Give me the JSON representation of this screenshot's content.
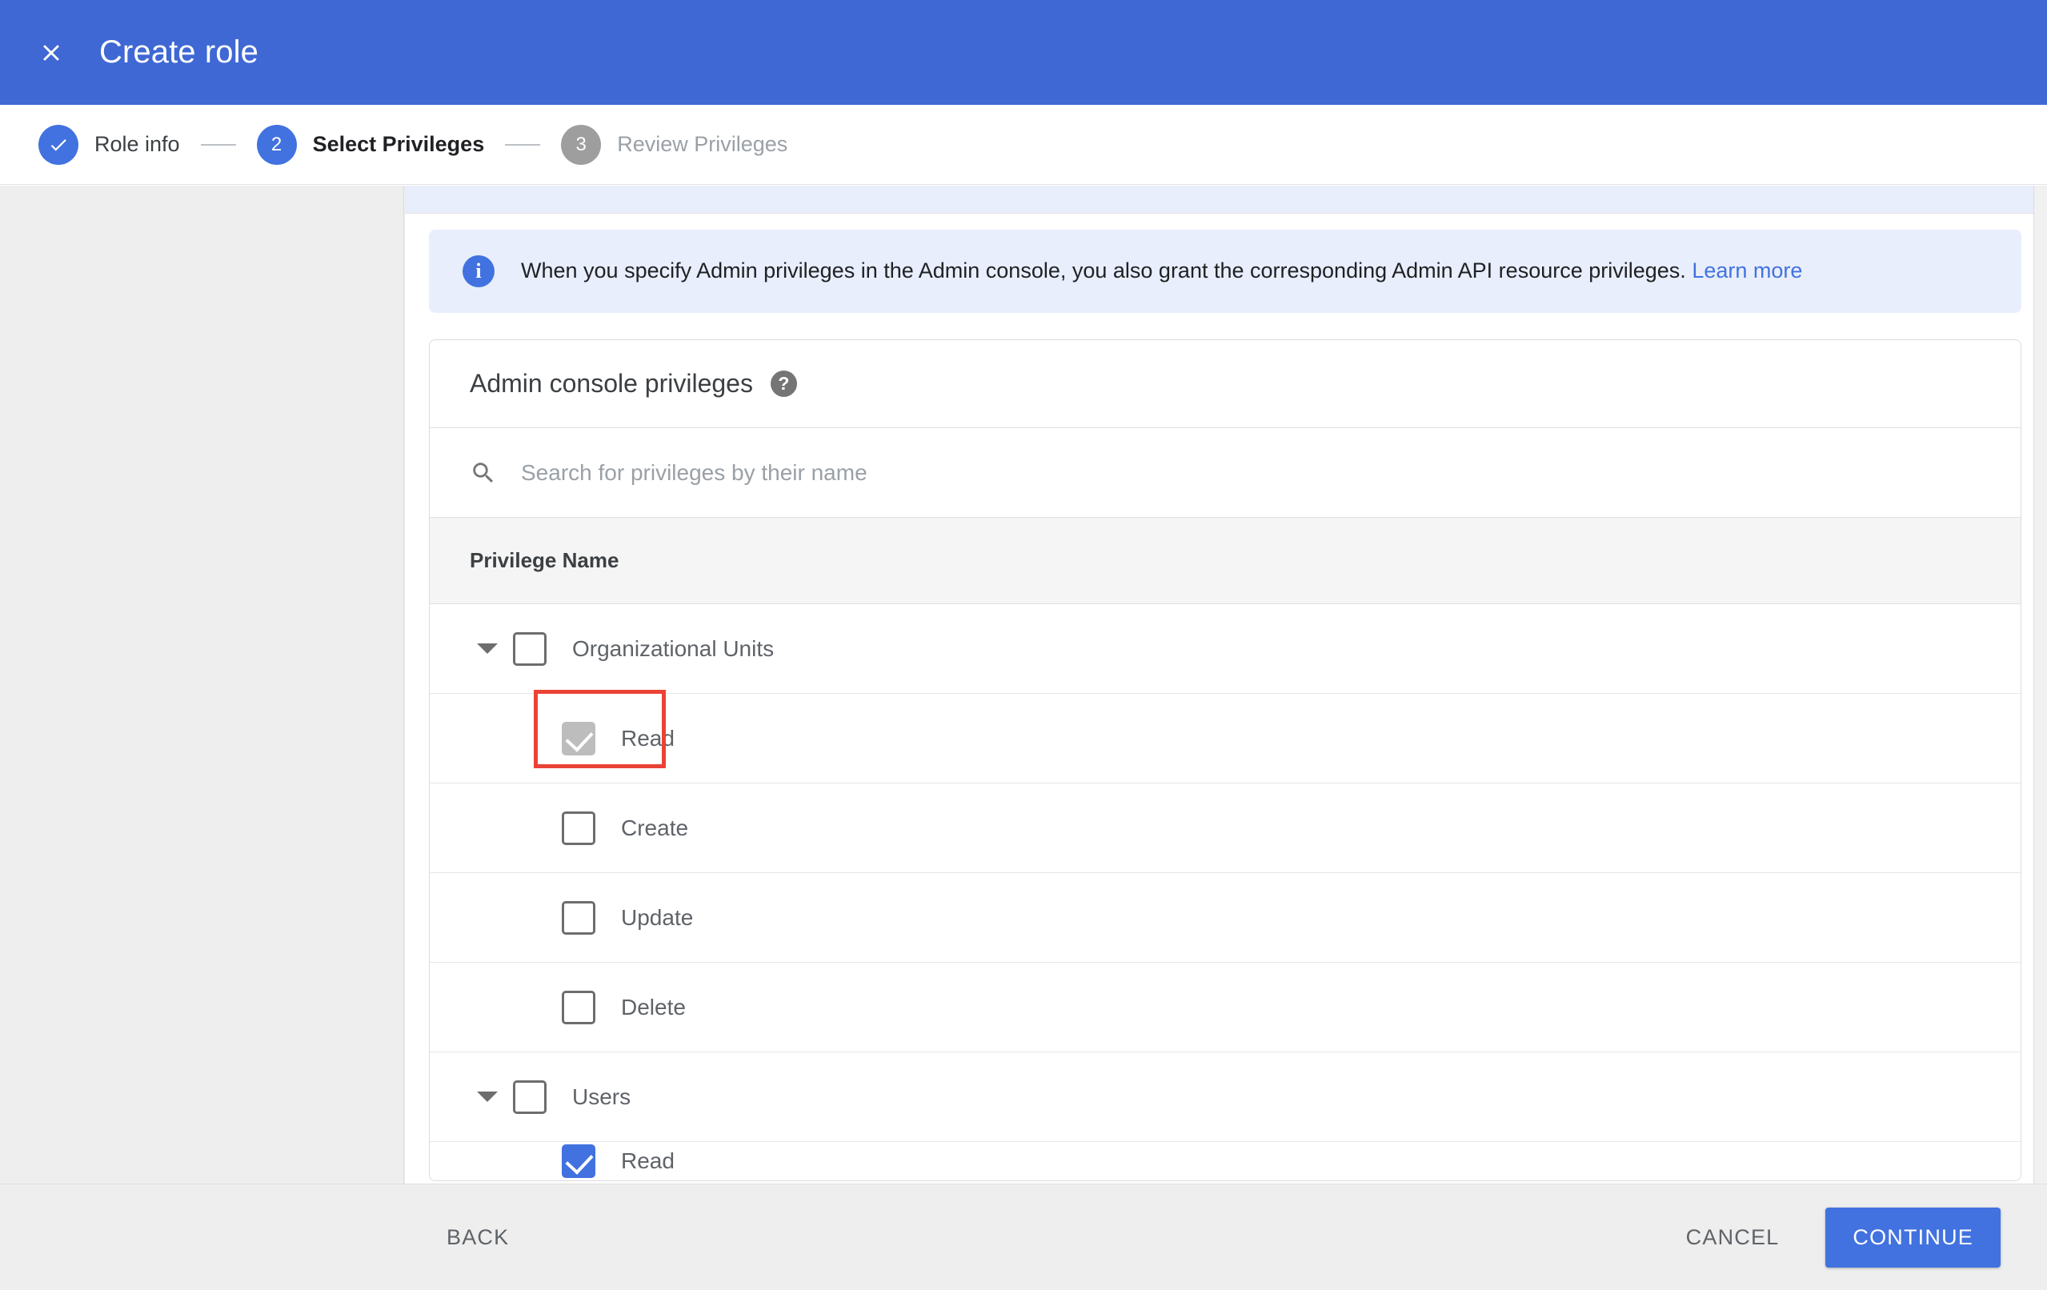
{
  "topbar": {
    "close_icon": "close-icon",
    "title": "Create role",
    "background_color": "#3f68d4"
  },
  "stepper": {
    "steps": [
      {
        "marker": "✓",
        "label": "Role info",
        "state": "done"
      },
      {
        "marker": "2",
        "label": "Select Privileges",
        "state": "active"
      },
      {
        "marker": "3",
        "label": "Review Privileges",
        "state": "inactive"
      }
    ]
  },
  "info_banner": {
    "icon": "info-icon",
    "text": "When you specify Admin privileges in the Admin console, you also grant the corresponding Admin API resource privileges.",
    "link_label": "Learn more",
    "background_color": "#e8eefc",
    "link_color": "#4272e0"
  },
  "privileges_card": {
    "title": "Admin console privileges",
    "help_icon": "help-icon",
    "search": {
      "icon": "search-icon",
      "value": "",
      "placeholder": "Search for privileges by their name"
    },
    "table": {
      "column_header": "Privilege Name",
      "rows": [
        {
          "label": "Organizational Units",
          "level": "group",
          "checked": false,
          "state": "unchecked",
          "caret": "chevron-down-icon"
        },
        {
          "label": "Read",
          "level": "child",
          "checked": true,
          "state": "checked-grey",
          "caret": ""
        },
        {
          "label": "Create",
          "level": "child",
          "checked": false,
          "state": "unchecked",
          "caret": ""
        },
        {
          "label": "Update",
          "level": "child",
          "checked": false,
          "state": "unchecked",
          "caret": ""
        },
        {
          "label": "Delete",
          "level": "child",
          "checked": false,
          "state": "unchecked",
          "caret": ""
        },
        {
          "label": "Users",
          "level": "group",
          "checked": false,
          "state": "unchecked",
          "caret": "chevron-down-icon"
        },
        {
          "label": "Read",
          "level": "child",
          "checked": true,
          "state": "checked-blue",
          "caret": ""
        }
      ]
    }
  },
  "annotation": {
    "highlight_color": "#ea4335",
    "target": "Read"
  },
  "footer": {
    "back_label": "BACK",
    "cancel_label": "CANCEL",
    "continue_label": "CONTINUE",
    "continue_color": "#4272e0"
  }
}
